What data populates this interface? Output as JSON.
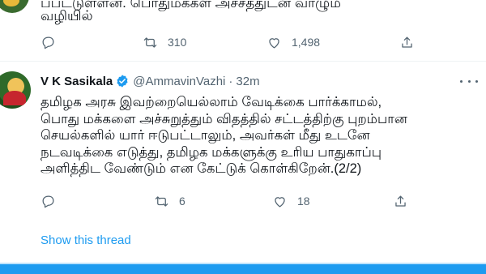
{
  "previous_tweet": {
    "cutoff_line": "ப்பட்டுள்ளன. பொதுமக்கள் அச்சத்துடன் வாழும்",
    "last_line": "வழியில்",
    "actions": {
      "retweets": "310",
      "likes": "1,498"
    }
  },
  "tweet": {
    "author_name": "V K Sasikala",
    "handle": "@AmmavinVazhi",
    "separator": "·",
    "time": "32m",
    "lines": [
      "தமிழக அரசு இவற்றையெல்லாம் வேடிக்கை பார்க்காமல்,",
      "பொது மக்களை அச்சுறுத்தும் விதத்தில் சட்டத்திற்கு புறம்பான",
      "செயல்களில் யார் ஈடுபட்டாலும், அவர்கள் மீது உடனே",
      "நடவடிக்கை எடுத்து, தமிழக மக்களுக்கு உரிய பாதுகாப்பு",
      "அளித்திட வேண்டும் என கேட்டுக் கொள்கிறேன்.(2/2)"
    ],
    "actions": {
      "retweets": "6",
      "likes": "18"
    }
  },
  "show_thread_label": "Show this thread",
  "colors": {
    "accent": "#1d9bf0",
    "muted": "#536471",
    "text": "#0f1419",
    "divider": "#eff3f4"
  },
  "icons": [
    "reply-icon",
    "retweet-icon",
    "like-icon",
    "share-icon",
    "verified-badge-icon",
    "more-icon"
  ]
}
